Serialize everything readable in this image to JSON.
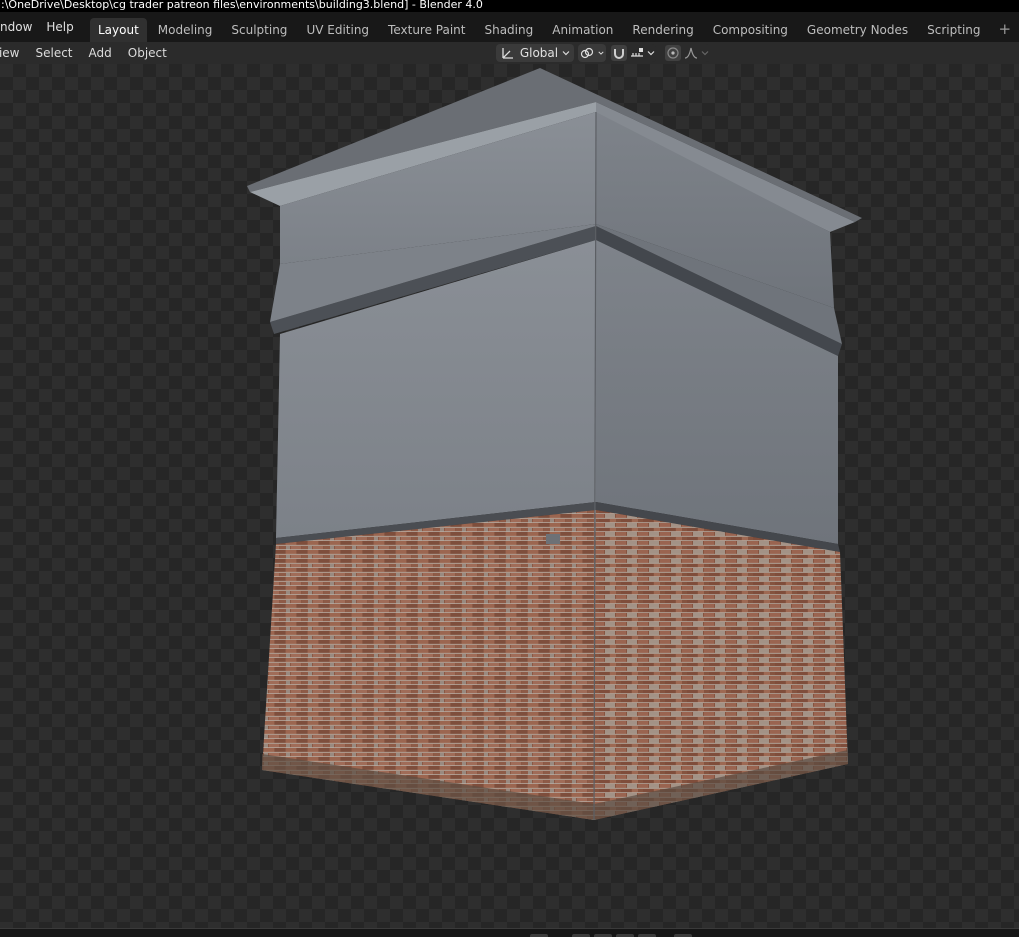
{
  "window": {
    "title": ":\\OneDrive\\Desktop\\cg trader patreon files\\environments\\building3.blend] - Blender 4.0"
  },
  "menubar": {
    "items": [
      "ndow",
      "Help"
    ]
  },
  "workspaces": {
    "tabs": [
      "Layout",
      "Modeling",
      "Sculpting",
      "UV Editing",
      "Texture Paint",
      "Shading",
      "Animation",
      "Rendering",
      "Compositing",
      "Geometry Nodes",
      "Scripting"
    ],
    "active": "Layout",
    "add_label": "+"
  },
  "viewport_header": {
    "menus": [
      "View",
      "Select",
      "Add",
      "Object"
    ],
    "orientation": "Global",
    "orientation_icon": "transform-orientation-icon",
    "pivot_icon": "pivot-link-icon",
    "snap_icon": "snap-magnet-icon",
    "snap_target_icon": "snap-increment-icon",
    "proportional_icon": "proportional-edit-icon",
    "falloff_icon": "falloff-curve-icon"
  },
  "colors": {
    "active_tab": "#303030",
    "header_bg": "#2b2b2b",
    "topbar_bg": "#181818"
  }
}
